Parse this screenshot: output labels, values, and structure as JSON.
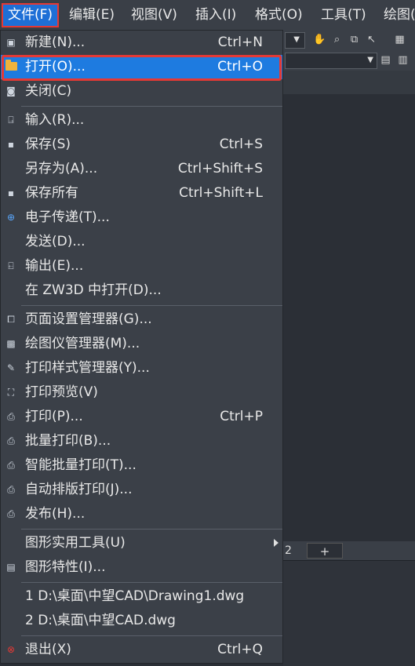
{
  "menubar": {
    "items": [
      "文件(F)",
      "编辑(E)",
      "视图(V)",
      "插入(I)",
      "格式(O)",
      "工具(T)",
      "绘图("
    ]
  },
  "tabs": {
    "tab2": "2",
    "plus": "+"
  },
  "file_menu": {
    "items": [
      {
        "label": "新建(N)...",
        "shortcut": "Ctrl+N",
        "icon": "new-file-icon"
      },
      {
        "label": "打开(O)...",
        "shortcut": "Ctrl+O",
        "icon": "folder-open-icon",
        "highlighted": true
      },
      {
        "label": "关闭(C)",
        "shortcut": "",
        "icon": "close-file-icon"
      },
      {
        "label": "输入(R)...",
        "shortcut": "",
        "icon": "import-icon"
      },
      {
        "label": "保存(S)",
        "shortcut": "Ctrl+S",
        "icon": "save-icon"
      },
      {
        "label": "另存为(A)...",
        "shortcut": "Ctrl+Shift+S",
        "icon": ""
      },
      {
        "label": "保存所有",
        "shortcut": "Ctrl+Shift+L",
        "icon": "save-all-icon"
      },
      {
        "label": "电子传递(T)...",
        "shortcut": "",
        "icon": "etransmit-icon"
      },
      {
        "label": "发送(D)...",
        "shortcut": "",
        "icon": ""
      },
      {
        "label": "输出(E)...",
        "shortcut": "",
        "icon": "export-icon"
      },
      {
        "label": "在 ZW3D 中打开(D)...",
        "shortcut": "",
        "icon": ""
      },
      {
        "label": "页面设置管理器(G)...",
        "shortcut": "",
        "icon": "page-setup-icon"
      },
      {
        "label": "绘图仪管理器(M)...",
        "shortcut": "",
        "icon": "plotter-icon"
      },
      {
        "label": "打印样式管理器(Y)...",
        "shortcut": "",
        "icon": "plot-style-icon"
      },
      {
        "label": "打印预览(V)",
        "shortcut": "",
        "icon": "print-preview-icon"
      },
      {
        "label": "打印(P)...",
        "shortcut": "Ctrl+P",
        "icon": "print-icon"
      },
      {
        "label": "批量打印(B)...",
        "shortcut": "",
        "icon": "batch-print-icon"
      },
      {
        "label": "智能批量打印(T)...",
        "shortcut": "",
        "icon": "smart-batch-print-icon"
      },
      {
        "label": "自动排版打印(J)...",
        "shortcut": "",
        "icon": "auto-layout-print-icon"
      },
      {
        "label": "发布(H)...",
        "shortcut": "",
        "icon": "publish-icon"
      },
      {
        "label": "图形实用工具(U)",
        "shortcut": "",
        "icon": "",
        "submenu": true
      },
      {
        "label": "图形特性(I)...",
        "shortcut": "",
        "icon": "drawing-properties-icon"
      },
      {
        "label": "1 D:\\桌面\\中望CAD\\Drawing1.dwg",
        "shortcut": "",
        "icon": ""
      },
      {
        "label": "2 D:\\桌面\\中望CAD.dwg",
        "shortcut": "",
        "icon": ""
      },
      {
        "label": "退出(X)",
        "shortcut": "Ctrl+Q",
        "icon": "exit-icon"
      }
    ]
  }
}
